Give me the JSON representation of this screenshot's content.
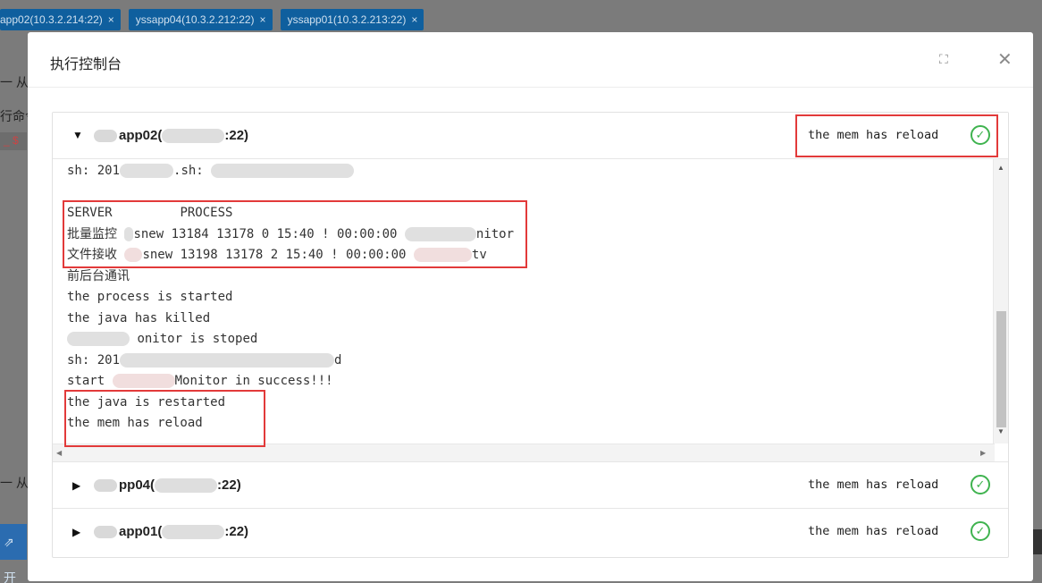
{
  "background": {
    "tabs": [
      {
        "label": "app02(10.3.2.214:22)"
      },
      {
        "label": "yssapp04(10.3.2.212:22)"
      },
      {
        "label": "yssapp01(10.3.2.213:22)"
      }
    ],
    "tab_close": "×",
    "side_text_1": "一 从",
    "side_text_2": "行命令",
    "side_text_3": "一 从",
    "button_text": "⇗ 开",
    "dollar": "_  $"
  },
  "modal": {
    "title": "执行控制台",
    "expand_icon": "⛶",
    "close_icon": "✕"
  },
  "groups": [
    {
      "host_prefix": "app02(",
      "host_suffix": ":22)",
      "arrow": "▼",
      "status": "the mem has reload",
      "expanded": true
    },
    {
      "host_prefix": "pp04(",
      "host_suffix": ":22)",
      "arrow": "▶",
      "status": "the mem has reload",
      "expanded": false
    },
    {
      "host_prefix": "app01(",
      "host_suffix": ":22)",
      "arrow": "▶",
      "status": "the mem has reload",
      "expanded": false
    }
  ],
  "console": {
    "line1_a": "sh: 201",
    "line1_b": ".sh:",
    "header_server": "SERVER",
    "header_process": "PROCESS",
    "row1_label": "批量监控",
    "row1_text": "snew 13184 13178 0 15:40 ! 00:00:00",
    "row1_tail": "nitor",
    "row2_label": "文件接收",
    "row2_text": "snew 13198 13178 2 15:40 ! 00:00:00",
    "row2_tail": "tv",
    "line_fe": "前后台通讯",
    "line_started": "the process is started",
    "line_killed": "the java has killed",
    "line_stoped": "onitor is stoped",
    "line_sh": "sh: 201",
    "line_sh_tail": "d",
    "line_start": "start",
    "line_start_tail": "Monitor in success!!!",
    "line_restarted": "the java is restarted",
    "line_reload": "the mem has reload"
  }
}
